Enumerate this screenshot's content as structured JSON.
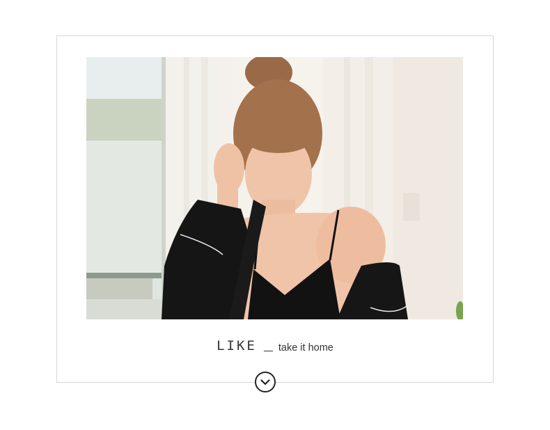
{
  "caption": {
    "title": "LIKE",
    "tagline": "take it home"
  },
  "photo": {
    "alt": "Model wearing black velvet robe and camisole"
  },
  "icons": {
    "scroll": "chevron-down-icon"
  },
  "colors": {
    "border": "#d6d6d6",
    "text": "#333333",
    "garment": "#111111"
  }
}
